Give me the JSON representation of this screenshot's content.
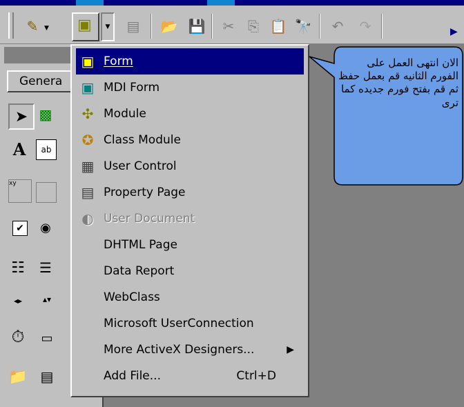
{
  "toolbar": {
    "icons": [
      "add-project-icon",
      "add-form-icon",
      "menu-editor-icon",
      "open-project-icon",
      "save-project-icon",
      "cut-icon",
      "copy-icon",
      "paste-icon",
      "find-icon",
      "undo-icon",
      "redo-icon",
      "more-icon"
    ]
  },
  "toolbox": {
    "tab_label": "Genera"
  },
  "menu": {
    "items": [
      {
        "label": "Form",
        "mnemonic": "F",
        "icon": "form-icon",
        "selected": true
      },
      {
        "label": "MDI Form",
        "icon": "mdi-form-icon"
      },
      {
        "label": "Module",
        "icon": "module-icon"
      },
      {
        "label": "Class Module",
        "icon": "class-module-icon"
      },
      {
        "label": "User Control",
        "icon": "user-control-icon"
      },
      {
        "label": "Property Page",
        "icon": "property-page-icon"
      },
      {
        "label": "User Document",
        "icon": "user-document-icon",
        "disabled": true
      },
      {
        "label": "DHTML Page"
      },
      {
        "label": "Data Report"
      },
      {
        "label": "WebClass"
      },
      {
        "label": "Microsoft UserConnection"
      },
      {
        "label": "More ActiveX Designers...",
        "submenu": true
      },
      {
        "label": "Add File...",
        "shortcut": "Ctrl+D"
      }
    ]
  },
  "callout": {
    "text": "الان انتهى العمل على الفورم الثانيه قم بعمل حفظ ثم قم بفتح فورم جديده كما ترى"
  },
  "colors": {
    "highlight": "#000080",
    "callout_fill": "#6b9de6",
    "face": "#c0c0c0",
    "workspace": "#808080"
  }
}
